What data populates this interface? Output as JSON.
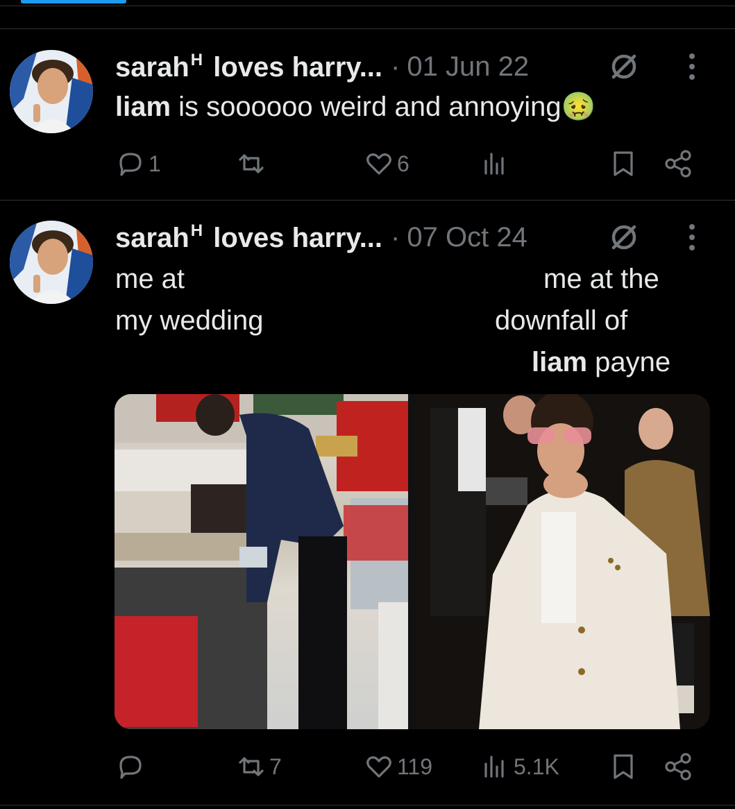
{
  "tweets": [
    {
      "author": "sarah",
      "author_sup": "H",
      "author_suffix": " loves harry...",
      "date": "01 Jun 22",
      "text_bold": "liam",
      "text_rest": " is soooooo weird and annoying",
      "emoji": "🤢",
      "reply_count": "1",
      "retweet_count": "",
      "like_count": "6",
      "view_count": ""
    },
    {
      "author": "sarah",
      "author_sup": "H",
      "author_suffix": " loves harry...",
      "date": "07 Oct 24",
      "left_caption_line1": "me  at",
      "left_caption_line2": "my wedding",
      "right_caption_line1": "me  at  the",
      "right_caption_line2": "downfall  of",
      "right_caption_bold": "liam",
      "right_caption_rest": " payne",
      "reply_count": "",
      "retweet_count": "7",
      "like_count": "119",
      "view_count": "5.1K"
    }
  ],
  "colors": {
    "background": "#000000",
    "text": "#e7e9ea",
    "muted": "#71767b",
    "divider": "#2f3336",
    "accent": "#1d9bf0"
  },
  "icons": [
    "mute-icon",
    "more-icon",
    "reply-icon",
    "retweet-icon",
    "like-icon",
    "views-icon",
    "bookmark-icon",
    "share-icon"
  ]
}
